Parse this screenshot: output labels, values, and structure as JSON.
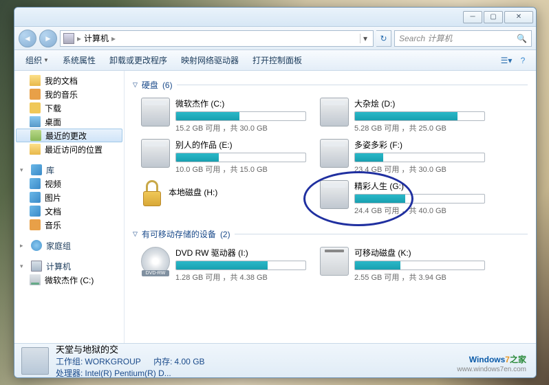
{
  "breadcrumb": {
    "root": "计算机"
  },
  "search": {
    "placeholder": "Search 计算机"
  },
  "toolbar": {
    "organize": "组织",
    "sysprops": "系统属性",
    "uninstall": "卸载或更改程序",
    "mapnet": "映射网络驱动器",
    "ctrlpanel": "打开控制面板"
  },
  "sidebar": {
    "fav_docs": "我的文档",
    "fav_music": "我的音乐",
    "fav_down": "下载",
    "fav_desk": "桌面",
    "fav_recent": "最近的更改",
    "fav_places": "最近访问的位置",
    "lib_hdr": "库",
    "lib_video": "视频",
    "lib_pic": "图片",
    "lib_doc": "文档",
    "lib_music": "音乐",
    "homegroup": "家庭组",
    "computer": "计算机",
    "drive_c": "微软杰作 (C:)"
  },
  "groups": {
    "hdd": {
      "label": "硬盘",
      "count": "(6)"
    },
    "rem": {
      "label": "有可移动存储的设备",
      "count": "(2)"
    }
  },
  "drives": [
    {
      "name": "微软杰作 (C:)",
      "free": "15.2 GB",
      "total": "30.0 GB",
      "pct": 49
    },
    {
      "name": "大杂烩 (D:)",
      "free": "5.28 GB",
      "total": "25.0 GB",
      "pct": 79
    },
    {
      "name": "别人的作品 (E:)",
      "free": "10.0 GB",
      "total": "15.0 GB",
      "pct": 33
    },
    {
      "name": "多姿多彩 (F:)",
      "free": "23.4 GB",
      "total": "30.0 GB",
      "pct": 22
    },
    {
      "name": "精彩人生 (G:)",
      "free": "24.4 GB",
      "total": "40.0 GB",
      "pct": 39
    }
  ],
  "locked_drive": {
    "name": "本地磁盘 (H:)"
  },
  "removable": [
    {
      "name": "DVD RW 驱动器 (I:)",
      "free": "1.28 GB",
      "total": "4.38 GB",
      "pct": 71,
      "type": "dvd"
    },
    {
      "name": "可移动磁盘 (K:)",
      "free": "2.55 GB",
      "total": "3.94 GB",
      "pct": 35,
      "type": "rm"
    }
  ],
  "stat_sep": " 可用 ，共 ",
  "status": {
    "name": "天堂与地狱的交",
    "wg_l": "工作组:",
    "wg_v": "WORKGROUP",
    "cpu_l": "处理器:",
    "cpu_v": "Intel(R) Pentium(R) D...",
    "mem_l": "内存:",
    "mem_v": "4.00 GB"
  },
  "wm": {
    "a": "Windows",
    "b": "7",
    "c": "之家",
    "url": "www.windows7en.com"
  }
}
